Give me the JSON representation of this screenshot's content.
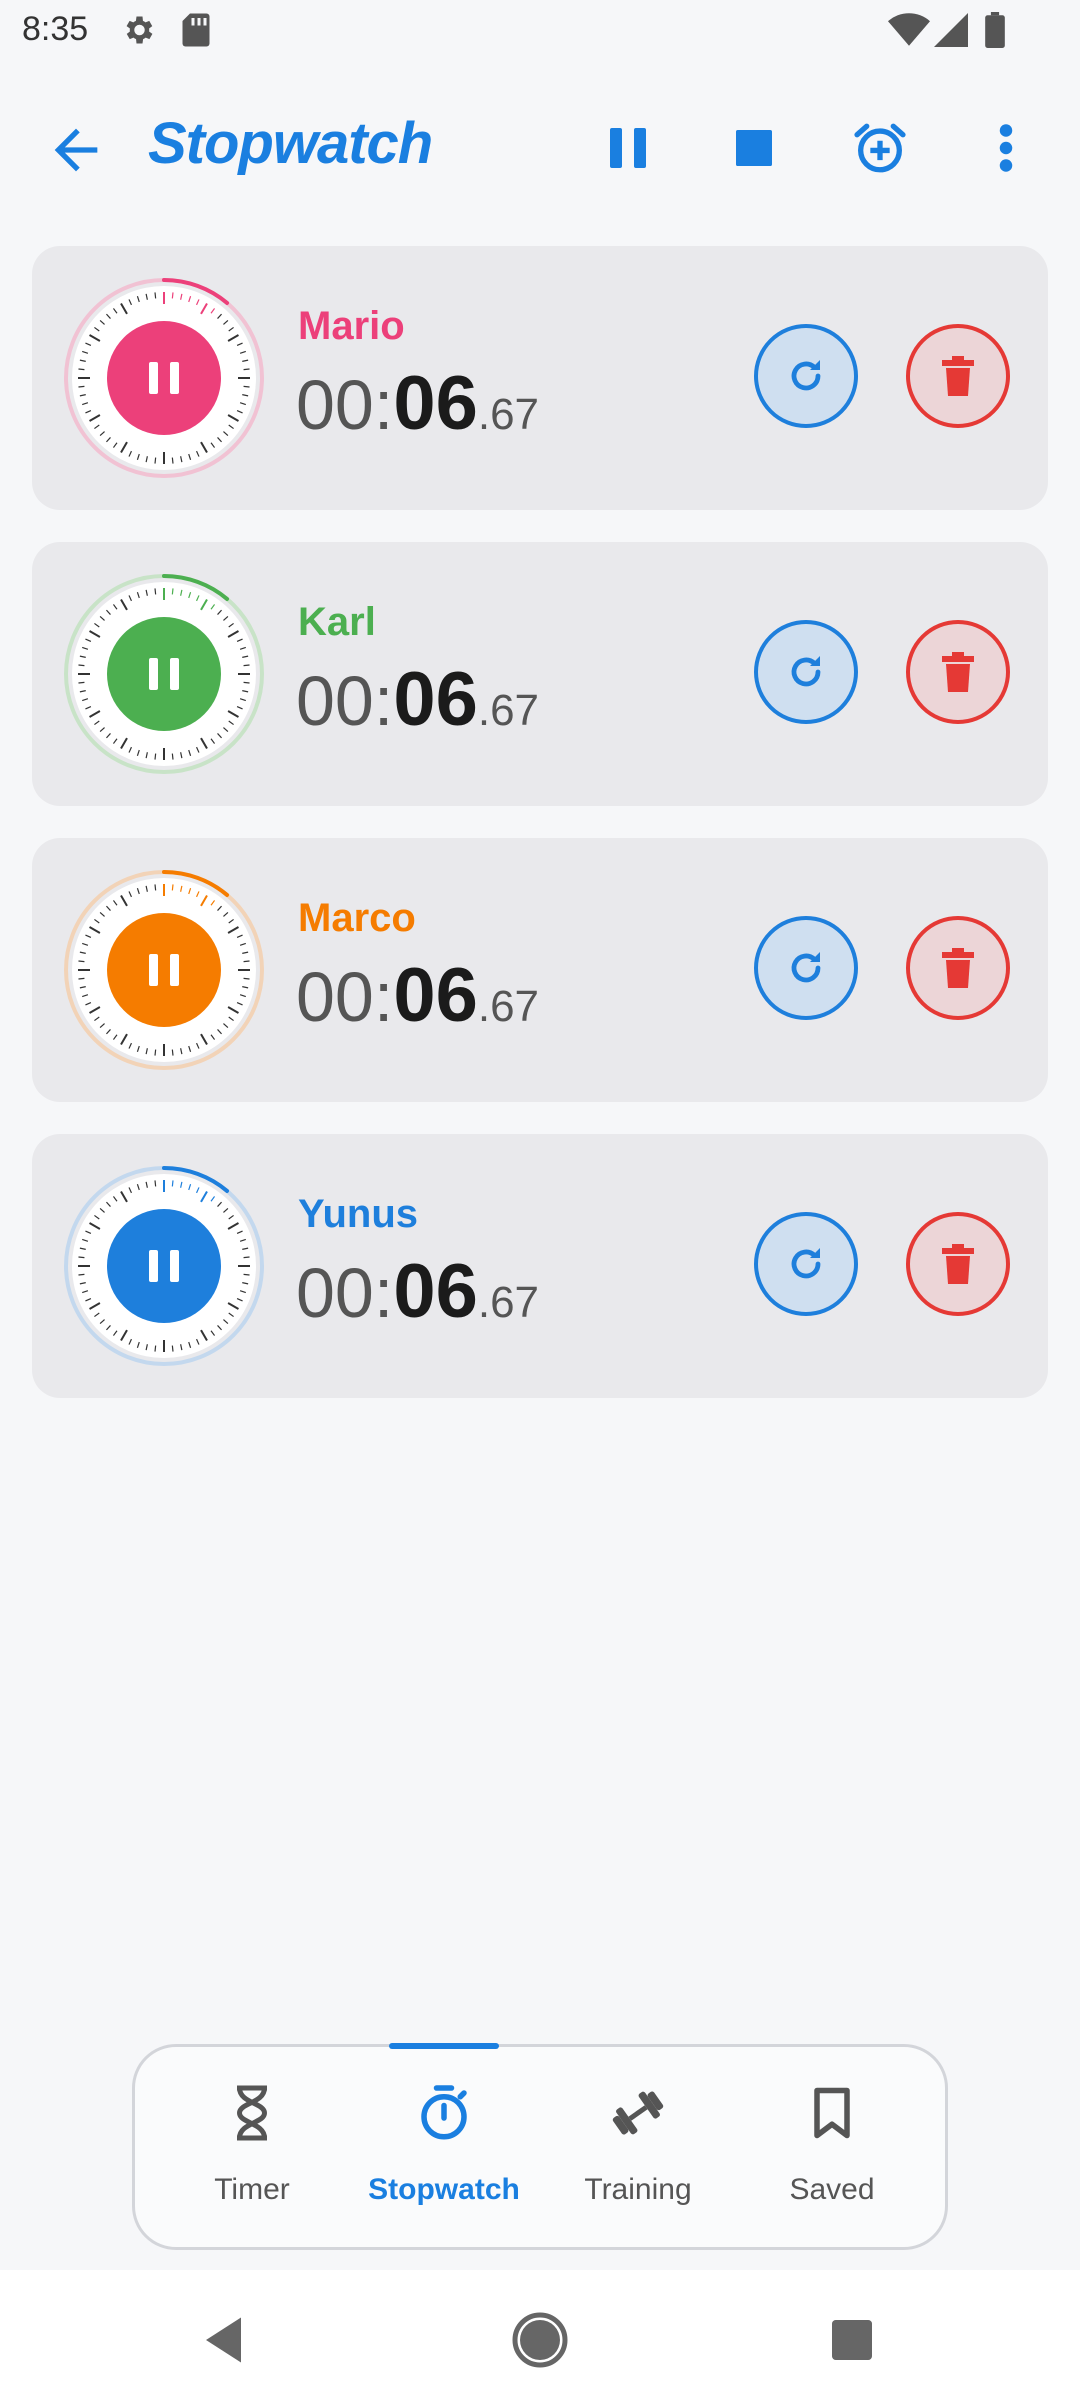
{
  "status_bar": {
    "time": "8:35",
    "icons": [
      "settings-icon",
      "sd-card-icon",
      "wifi-icon",
      "cellular-icon",
      "battery-icon"
    ]
  },
  "app_bar": {
    "title": "Stopwatch",
    "actions": [
      "pause-all-icon",
      "stop-all-icon",
      "add-alarm-icon",
      "more-vert-icon"
    ],
    "accent": "#1a7fe0"
  },
  "stopwatches": [
    {
      "name": "Mario",
      "minutes": "00:",
      "seconds": "06",
      "centis": ".67",
      "color": "#ec407a",
      "light": "#f1c2d3"
    },
    {
      "name": "Karl",
      "minutes": "00:",
      "seconds": "06",
      "centis": ".67",
      "color": "#4caf50",
      "light": "#c8e3c7"
    },
    {
      "name": "Marco",
      "minutes": "00:",
      "seconds": "06",
      "centis": ".67",
      "color": "#f57c00",
      "light": "#f2d3b7"
    },
    {
      "name": "Yunus",
      "minutes": "00:",
      "seconds": "06",
      "centis": ".67",
      "color": "#1e7fdc",
      "light": "#c3d8ee"
    }
  ],
  "bottom_nav": {
    "items": [
      {
        "label": "Timer",
        "icon": "hourglass-icon"
      },
      {
        "label": "Stopwatch",
        "icon": "stopwatch-icon"
      },
      {
        "label": "Training",
        "icon": "dumbbell-icon"
      },
      {
        "label": "Saved",
        "icon": "bookmark-icon"
      }
    ],
    "active": "Stopwatch"
  },
  "system_nav": [
    "back-icon",
    "home-icon",
    "recents-icon"
  ]
}
